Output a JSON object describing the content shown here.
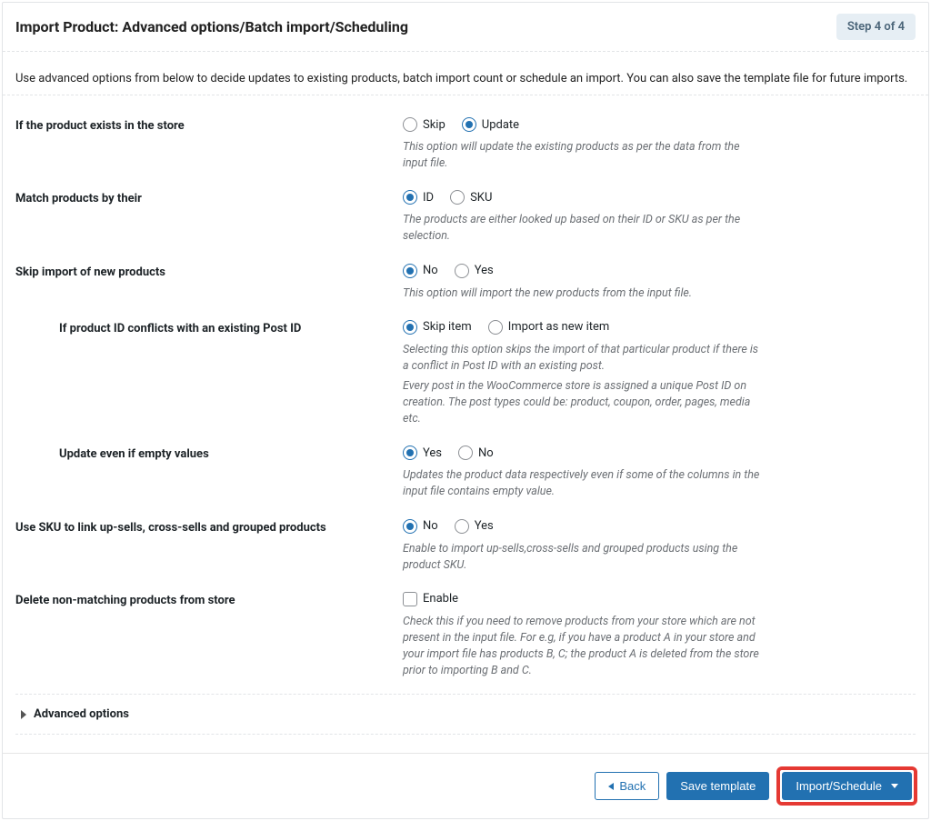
{
  "header": {
    "title": "Import Product: Advanced options/Batch import/Scheduling",
    "step": "Step 4 of 4"
  },
  "intro": "Use advanced options from below to decide updates to existing products, batch import count or schedule an import. You can also save the template file for future imports.",
  "rows": {
    "exists": {
      "label": "If the product exists in the store",
      "opt1": "Skip",
      "opt2": "Update",
      "help": "This option will update the existing products as per the data from the input file."
    },
    "match": {
      "label": "Match products by their",
      "opt1": "ID",
      "opt2": "SKU",
      "help": "The products are either looked up based on their ID or SKU as per the selection."
    },
    "skipnew": {
      "label": "Skip import of new products",
      "opt1": "No",
      "opt2": "Yes",
      "help": "This option will import the new products from the input file."
    },
    "conflict": {
      "label": "If product ID conflicts with an existing Post ID",
      "opt1": "Skip item",
      "opt2": "Import as new item",
      "help1": "Selecting this option skips the import of that particular product if there is a conflict in Post ID with an existing post.",
      "help2": "Every post in the WooCommerce store is assigned a unique Post ID on creation. The post types could be: product, coupon, order, pages, media etc."
    },
    "empty": {
      "label": "Update even if empty values",
      "opt1": "Yes",
      "opt2": "No",
      "help": "Updates the product data respectively even if some of the columns in the input file contains empty value."
    },
    "sku": {
      "label": "Use SKU to link up-sells, cross-sells and grouped products",
      "opt1": "No",
      "opt2": "Yes",
      "help": "Enable to import up-sells,cross-sells and grouped products using the product SKU."
    },
    "delete": {
      "label": "Delete non-matching products from store",
      "opt1": "Enable",
      "help": "Check this if you need to remove products from your store which are not present in the input file. For e.g, if you have a product A in your store and your import file has products B, C; the product A is deleted from the store prior to importing B and C."
    }
  },
  "advanced": "Advanced options",
  "footer": {
    "back": "Back",
    "save": "Save template",
    "import": "Import/Schedule"
  }
}
